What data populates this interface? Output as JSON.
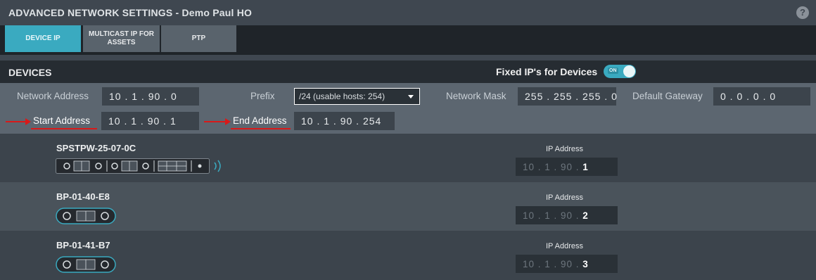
{
  "window": {
    "title": "ADVANCED NETWORK SETTINGS - Demo Paul HO",
    "help_glyph": "?"
  },
  "tabs": [
    {
      "label": "DEVICE IP",
      "active": true
    },
    {
      "label": "MULTICAST IP FOR ASSETS",
      "active": false
    },
    {
      "label": "PTP",
      "active": false
    }
  ],
  "devices_section": {
    "title": "DEVICES",
    "fixed_ip_label": "Fixed IP's for Devices",
    "fixed_ip_toggle": "ON"
  },
  "network": {
    "network_address_label": "Network Address",
    "network_address": "10 . 1 . 90 . 0",
    "prefix_label": "Prefix",
    "prefix_value": "/24 (usable hosts: 254)",
    "network_mask_label": "Network Mask",
    "network_mask": "255 . 255 . 255 . 0",
    "default_gateway_label": "Default Gateway",
    "default_gateway": "0 . 0 . 0 . 0",
    "start_address_label": "Start Address",
    "start_address": "10 . 1 . 90 . 1",
    "end_address_label": "End Address",
    "end_address": "10 . 1 . 90 . 254"
  },
  "devices": [
    {
      "name": "SPSTPW-25-07-0C",
      "ip_label": "IP Address",
      "ip_prefix": "10 . 1 . 90 . ",
      "ip_last": "1"
    },
    {
      "name": "BP-01-40-E8",
      "ip_label": "IP Address",
      "ip_prefix": "10 . 1 . 90 . ",
      "ip_last": "2"
    },
    {
      "name": "BP-01-41-B7",
      "ip_label": "IP Address",
      "ip_prefix": "10 . 1 . 90 . ",
      "ip_last": "3"
    }
  ],
  "colors": {
    "accent": "#3aaac0",
    "annotation_red": "#d81a1a"
  }
}
